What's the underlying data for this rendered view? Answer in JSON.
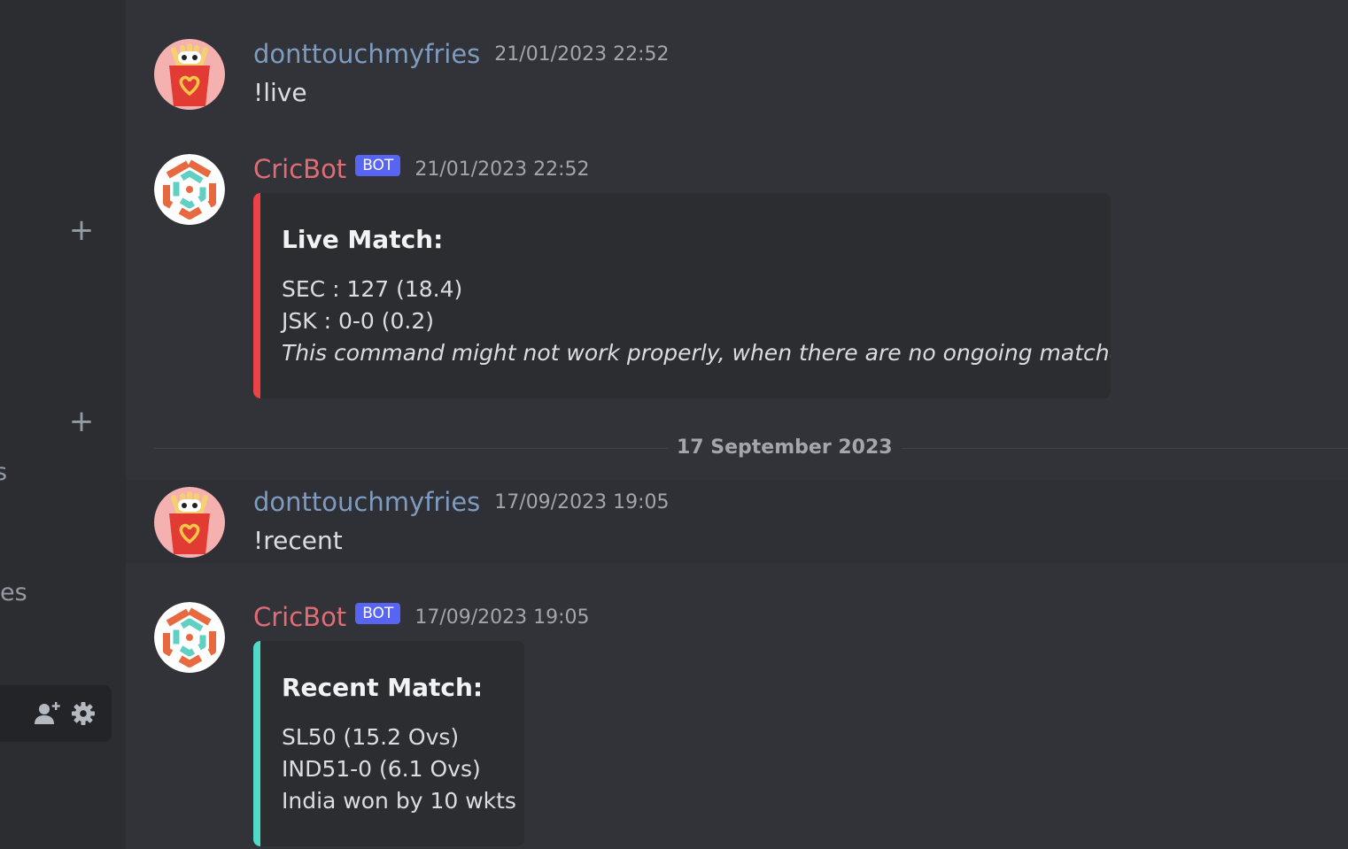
{
  "sidebar": {
    "fragments": [
      "s",
      "es"
    ],
    "icons": [
      "plus-icon",
      "plus-icon",
      "add-member-icon",
      "settings-gear-icon"
    ]
  },
  "messages": [
    {
      "author": "donttouchmyfries",
      "timestamp": "21/01/2023 22:52",
      "text": "!live"
    },
    {
      "author": "CricBot",
      "bot_tag": "BOT",
      "timestamp": "21/01/2023 22:52",
      "embed": {
        "title": "Live Match:",
        "accent": "#ed4245",
        "lines": [
          "SEC : 127 (18.4)",
          "JSK : 0-0 (0.2)",
          "This command might not work properly, when there are no ongoing matches."
        ]
      }
    },
    {
      "author": "donttouchmyfries",
      "timestamp": "17/09/2023 19:05",
      "text": "!recent"
    },
    {
      "author": "CricBot",
      "bot_tag": "BOT",
      "timestamp": "17/09/2023 19:05",
      "embed": {
        "title": "Recent Match:",
        "accent": "#4fdbc8",
        "lines": [
          "SL50 (15.2 Ovs)",
          "IND51-0 (6.1 Ovs)",
          "India won by 10 wkts"
        ]
      }
    }
  ],
  "date_divider": "17 September 2023",
  "colors": {
    "user_name": "#7e9bc0",
    "bot_name": "#e06c75",
    "bot_tag": "#5865f2",
    "background": "#313338"
  }
}
